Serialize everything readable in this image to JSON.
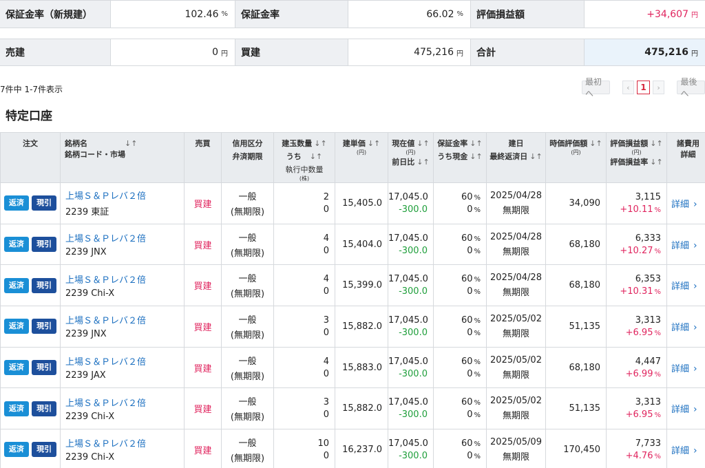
{
  "summary": {
    "row1": [
      {
        "label": "保証金率（新規建）",
        "value": "102.46",
        "unit": "%"
      },
      {
        "label": "保証金率",
        "value": "66.02",
        "unit": "%"
      },
      {
        "label": "評価損益額",
        "value": "+34,607",
        "unit": "円"
      }
    ],
    "row2": [
      {
        "label": "売建",
        "value": "0",
        "unit": "円"
      },
      {
        "label": "買建",
        "value": "475,216",
        "unit": "円"
      },
      {
        "label": "合計",
        "value": "475,216",
        "unit": "円"
      }
    ]
  },
  "count_text": "7件中 1-7件表示",
  "pager": {
    "first": "最初へ",
    "prev": "‹",
    "current": "1",
    "next": "›",
    "last": "最後へ"
  },
  "section_title": "特定口座",
  "headers": {
    "order": "注文",
    "name1": "銘柄名",
    "name2": "銘柄コード・市場",
    "side": "売買",
    "credit1": "信用区分",
    "credit2": "弁済期限",
    "qty1": "建玉数量",
    "qty2": "うち",
    "qty3": "執行中数量",
    "qty_unit": "(株)",
    "cost1": "建単価",
    "cost_unit": "(円)",
    "price1": "現在値",
    "price_unit": "(円)",
    "price2": "前日比",
    "margin1": "保証金率",
    "margin2": "うち現金",
    "date1": "建日",
    "date2": "最終返済日",
    "mv1": "時価評価額",
    "mv_unit": "(円)",
    "pl1": "評価損益額",
    "pl_unit": "(円)",
    "pl2": "評価損益率",
    "fee1": "諸費用",
    "fee2": "詳細",
    "sort": "↓↑"
  },
  "buttons": {
    "hensai": "返済",
    "genbiki": "現引"
  },
  "detail_label": "詳細",
  "units": {
    "pct": "%"
  },
  "rows": [
    {
      "name": "上場Ｓ＆Ｐレバ２倍",
      "code": "2239 東証",
      "side": "買建",
      "credit": "一般",
      "limit": "(無期限)",
      "qty": "2",
      "exec": "0",
      "cost": "15,405.0",
      "price": "17,045.0",
      "change": "-300.0",
      "margin": "60",
      "cash": "0",
      "date": "2025/04/28",
      "last": "無期限",
      "mv": "34,090",
      "pl": "3,115",
      "plr": "+10.11"
    },
    {
      "name": "上場Ｓ＆Ｐレバ２倍",
      "code": "2239 JNX",
      "side": "買建",
      "credit": "一般",
      "limit": "(無期限)",
      "qty": "4",
      "exec": "0",
      "cost": "15,404.0",
      "price": "17,045.0",
      "change": "-300.0",
      "margin": "60",
      "cash": "0",
      "date": "2025/04/28",
      "last": "無期限",
      "mv": "68,180",
      "pl": "6,333",
      "plr": "+10.27"
    },
    {
      "name": "上場Ｓ＆Ｐレバ２倍",
      "code": "2239 Chi-X",
      "side": "買建",
      "credit": "一般",
      "limit": "(無期限)",
      "qty": "4",
      "exec": "0",
      "cost": "15,399.0",
      "price": "17,045.0",
      "change": "-300.0",
      "margin": "60",
      "cash": "0",
      "date": "2025/04/28",
      "last": "無期限",
      "mv": "68,180",
      "pl": "6,353",
      "plr": "+10.31"
    },
    {
      "name": "上場Ｓ＆Ｐレバ２倍",
      "code": "2239 JNX",
      "side": "買建",
      "credit": "一般",
      "limit": "(無期限)",
      "qty": "3",
      "exec": "0",
      "cost": "15,882.0",
      "price": "17,045.0",
      "change": "-300.0",
      "margin": "60",
      "cash": "0",
      "date": "2025/05/02",
      "last": "無期限",
      "mv": "51,135",
      "pl": "3,313",
      "plr": "+6.95"
    },
    {
      "name": "上場Ｓ＆Ｐレバ２倍",
      "code": "2239 JAX",
      "side": "買建",
      "credit": "一般",
      "limit": "(無期限)",
      "qty": "4",
      "exec": "0",
      "cost": "15,883.0",
      "price": "17,045.0",
      "change": "-300.0",
      "margin": "60",
      "cash": "0",
      "date": "2025/05/02",
      "last": "無期限",
      "mv": "68,180",
      "pl": "4,447",
      "plr": "+6.99"
    },
    {
      "name": "上場Ｓ＆Ｐレバ２倍",
      "code": "2239 Chi-X",
      "side": "買建",
      "credit": "一般",
      "limit": "(無期限)",
      "qty": "3",
      "exec": "0",
      "cost": "15,882.0",
      "price": "17,045.0",
      "change": "-300.0",
      "margin": "60",
      "cash": "0",
      "date": "2025/05/02",
      "last": "無期限",
      "mv": "51,135",
      "pl": "3,313",
      "plr": "+6.95"
    },
    {
      "name": "上場Ｓ＆Ｐレバ２倍",
      "code": "2239 Chi-X",
      "side": "買建",
      "credit": "一般",
      "limit": "(無期限)",
      "qty": "10",
      "exec": "0",
      "cost": "16,237.0",
      "price": "17,045.0",
      "change": "-300.0",
      "margin": "60",
      "cash": "0",
      "date": "2025/05/09",
      "last": "無期限",
      "mv": "170,450",
      "pl": "7,733",
      "plr": "+4.76"
    }
  ]
}
